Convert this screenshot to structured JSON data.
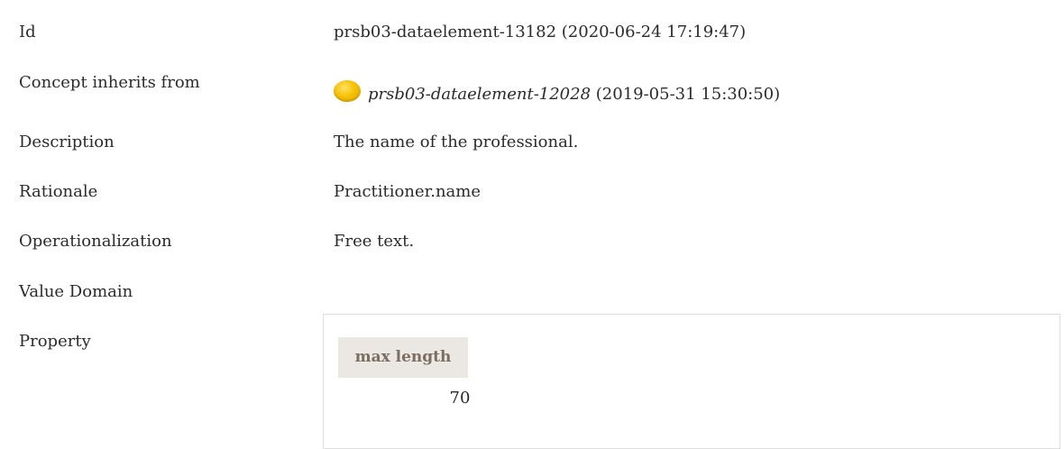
{
  "rows": {
    "id": {
      "label": "Id",
      "value": "prsb03-dataelement-13182 (2020-06-24 17:19:47)"
    },
    "inherits": {
      "label": "Concept inherits from",
      "link": "prsb03-dataelement-12028",
      "date": " (2019-05-31 15:30:50)",
      "status_icon": "yellow-status-circle-icon",
      "status_color": "#f5c200"
    },
    "description": {
      "label": "Description",
      "value": "The name of the professional."
    },
    "rationale": {
      "label": "Rationale",
      "value": "Practitioner.name"
    },
    "operationalization": {
      "label": "Operationalization",
      "value": "Free text."
    },
    "value_domain": {
      "label": "Value Domain"
    },
    "property": {
      "label": "Property",
      "header": "max length",
      "value": "70"
    }
  }
}
